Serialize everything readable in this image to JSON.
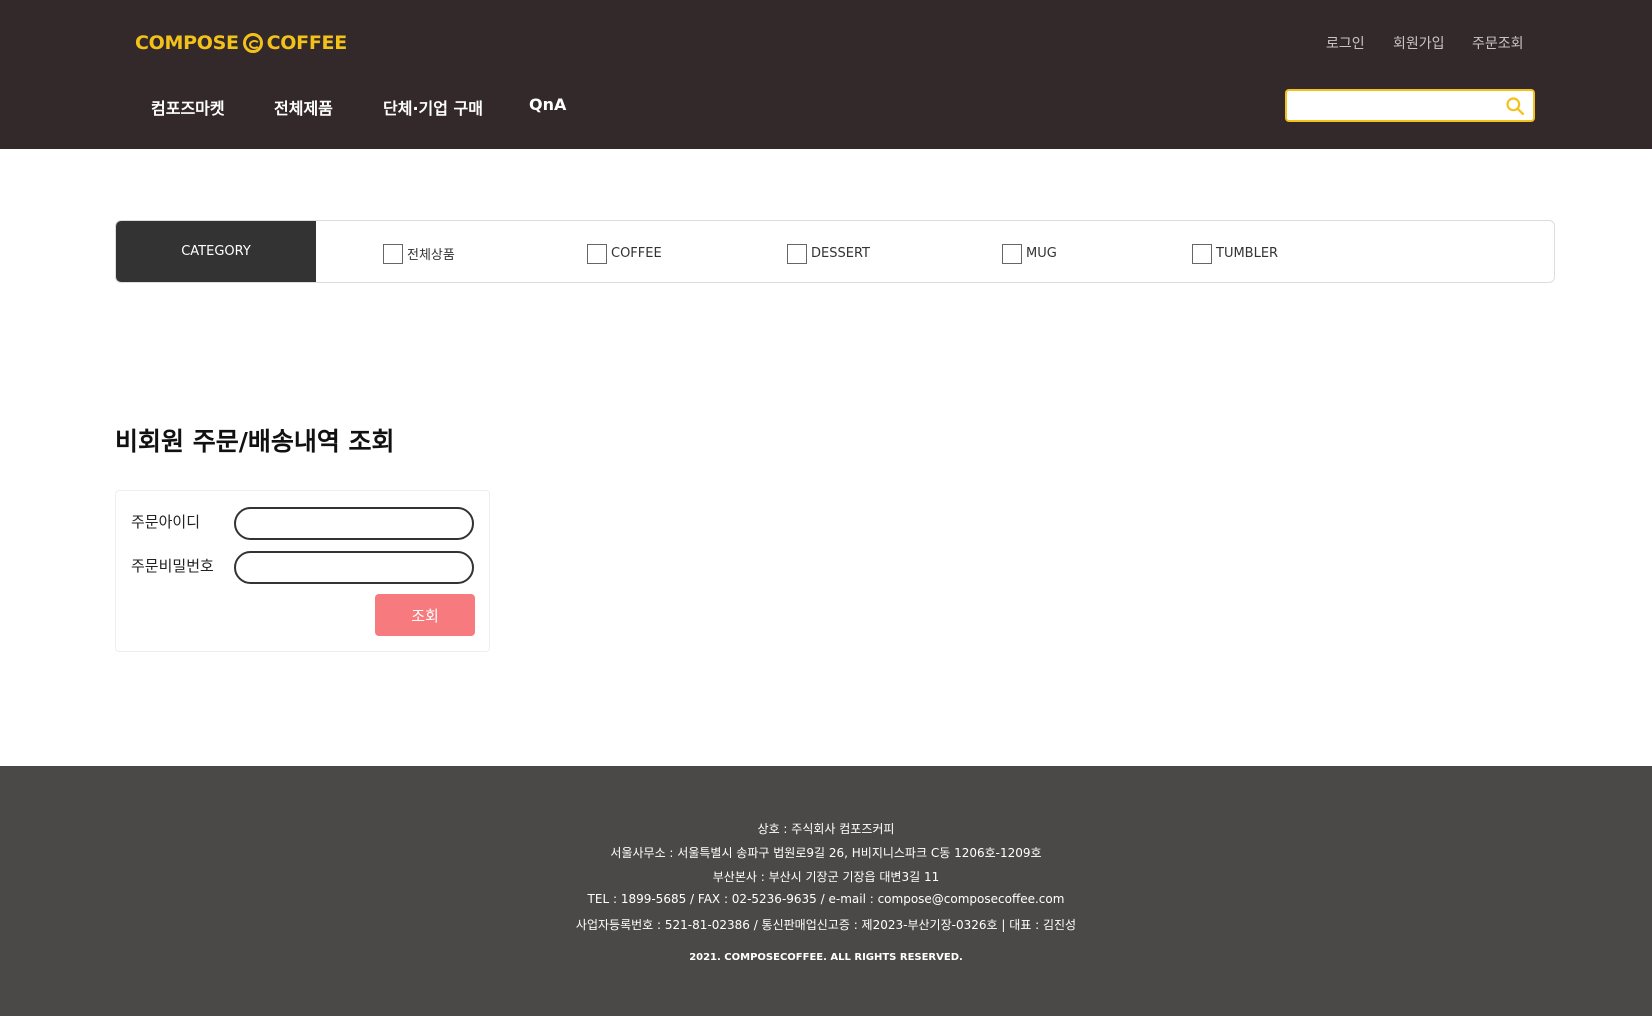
{
  "brand": {
    "logo_left": "COMPOSE",
    "logo_right": "COFFEE",
    "accent": "#f2c21b",
    "header_bg": "#33292a"
  },
  "top_links": [
    "로그인",
    "회원가입",
    "주문조회"
  ],
  "nav": [
    "컴포즈마켓",
    "전체제품",
    "단체·기업 구매",
    "QnA"
  ],
  "search": {
    "placeholder": "",
    "icon": "search-icon"
  },
  "category": {
    "label": "CATEGORY",
    "options": [
      {
        "label": "전체상품",
        "checked": false
      },
      {
        "label": "COFFEE",
        "checked": false
      },
      {
        "label": "DESSERT",
        "checked": false
      },
      {
        "label": "MUG",
        "checked": false
      },
      {
        "label": "TUMBLER",
        "checked": false
      }
    ]
  },
  "main": {
    "title": "비회원 주문/배송내역 조회",
    "fields": [
      {
        "label": "주문아이디",
        "value": ""
      },
      {
        "label": "주문비밀번호",
        "value": ""
      }
    ],
    "submit_label": "조회",
    "submit_color": "#f77b7e"
  },
  "footer": {
    "lines": [
      "상호 : 주식회사 컴포즈커피",
      "서울사무소 : 서울특별시 송파구 법원로9길 26, H비지니스파크 C동 1206호-1209호",
      "부산본사 : 부산시 기장군 기장읍 대변3길 11",
      "TEL : 1899-5685 / FAX : 02-5236-9635 / e-mail : compose@composecoffee.com",
      "사업자등록번호 : 521-81-02386 / 통신판매업신고증 : 제2023-부산기장-0326호 | 대표 : 김진성"
    ],
    "copyright": "2021. COMPOSECOFFEE. ALL RIGHTS RESERVED.",
    "bg": "#4a4948"
  }
}
